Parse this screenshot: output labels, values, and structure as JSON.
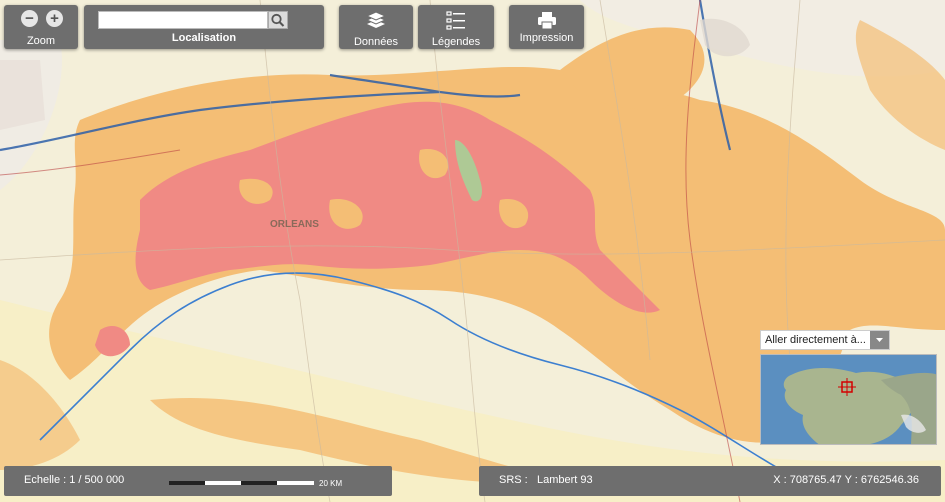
{
  "toolbar": {
    "zoom": {
      "label": "Zoom",
      "minus": "−",
      "plus": "+"
    },
    "search": {
      "label": "Localisation",
      "value": "",
      "placeholder": ""
    },
    "donnees_label": "Données",
    "legendes_label": "Légendes",
    "impression_label": "Impression"
  },
  "map": {
    "city_label": "ORLEANS",
    "colors": {
      "background": "#f4efd9",
      "orange": "#f4be75",
      "red": "#f08a84",
      "river": "#3c7fd0",
      "road": "#2d5fa8"
    }
  },
  "goto": {
    "label": "Aller directement à..."
  },
  "status": {
    "scale_label": "Echelle : 1 / 500 000",
    "scalebar_unit": "20 KM",
    "srs_label": "SRS :",
    "srs_value": "Lambert 93",
    "coords": "X : 708765.47 Y : 6762546.36"
  },
  "icons": [
    "minus-icon",
    "plus-icon",
    "search-icon",
    "layers-icon",
    "legend-list-icon",
    "printer-icon",
    "chevron-down-icon",
    "location-marker-icon"
  ]
}
